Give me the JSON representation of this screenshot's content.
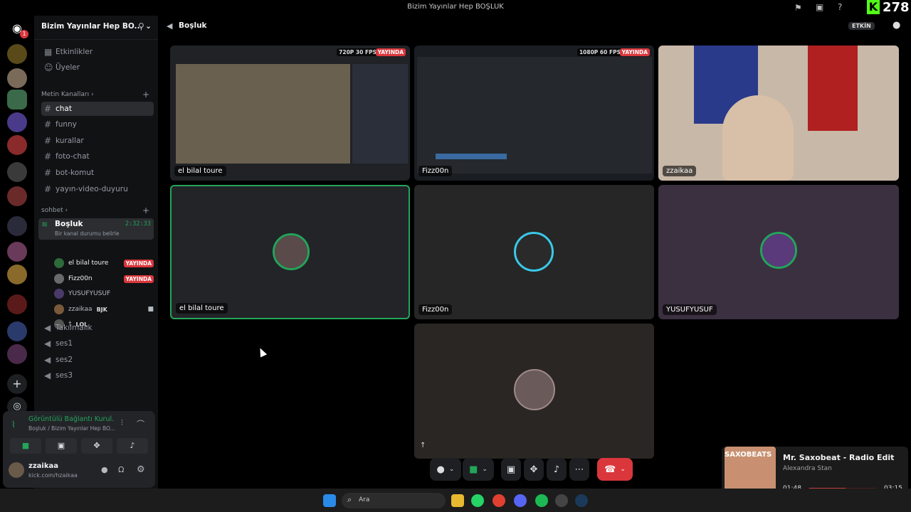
{
  "window": {
    "title": "Bizim Yayınlar Hep BOŞLUK",
    "score": "278",
    "logo_letter": "K"
  },
  "server": {
    "name": "Bizim Yayınlar Hep BO...",
    "dm_badge": "1"
  },
  "nav": {
    "events": "Etkinlikler",
    "members": "Üyeler"
  },
  "text_section": "Metin Kanalları",
  "text_channels": [
    "chat",
    "funny",
    "kurallar",
    "foto-chat",
    "bot-komut",
    "yayın-video-duyuru"
  ],
  "voice_section": "sohbet",
  "voice_channel": {
    "name": "Boşluk",
    "timer": "2:32:33",
    "status": "Bir kanal durumu belirle"
  },
  "voice_users": [
    {
      "name": "el bilal toure",
      "badge": "YAYINDA",
      "color": "#2d6b3a"
    },
    {
      "name": "Fizz00n",
      "badge": "YAYINDA",
      "color": "#6a6a6a"
    },
    {
      "name": "YUSUFYUSUF",
      "badge": "",
      "color": "#4a3a6a"
    },
    {
      "name": "zzaikaa",
      "badge": "BJK",
      "color": "#7a5a3a"
    },
    {
      "name": "†",
      "badge": "LOL",
      "color": "#555"
    }
  ],
  "other_voice": [
    "Takılmalık",
    "ses1",
    "ses2",
    "ses3"
  ],
  "conn": {
    "status": "Görüntülü Bağlantı Kurul...",
    "sub": "Boşluk / Bizim Yayınlar Hep BO..."
  },
  "user": {
    "name": "zzaikaa",
    "sub": "kick.com/hzaikaa"
  },
  "header": {
    "channel": "Boşluk",
    "activity": "ETKİN"
  },
  "tiles": [
    {
      "name": "el bilal toure",
      "meta": "720P 30 FPS",
      "live": "YAYINDA"
    },
    {
      "name": "Fizz00n",
      "meta": "1080P 60 FPS",
      "live": "YAYINDA"
    },
    {
      "name": "zzaikaa"
    },
    {
      "name": "el bilal toure"
    },
    {
      "name": "Fizz00n"
    },
    {
      "name": "YUSUFYUSUF"
    }
  ],
  "spotify": {
    "title": "Mr. Saxobeat - Radio Edit",
    "artist": "Alexandra Stan",
    "elapsed": "01:48",
    "total": "03:15",
    "cover_text": "SAXOBEATS",
    "progress": 0.55
  },
  "taskbar": {
    "search": "Ara"
  },
  "colors": {
    "accent": "#23a55a",
    "live": "#da373c",
    "hangup": "#da373c"
  }
}
